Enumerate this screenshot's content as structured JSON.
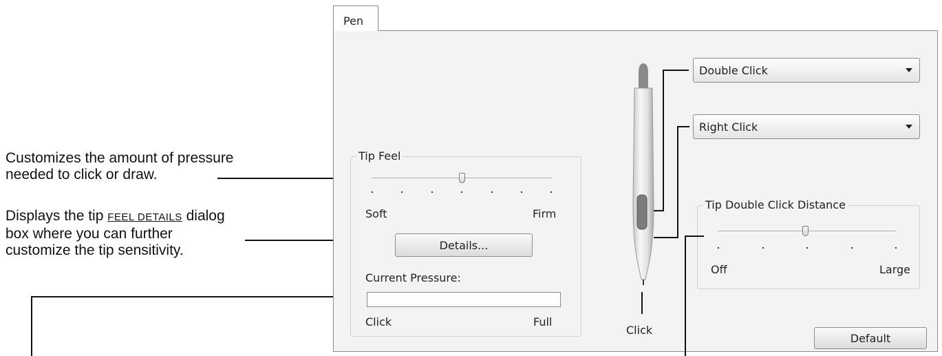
{
  "annotations": {
    "tip_feel_line1": "Customizes the amount of pressure",
    "tip_feel_line2": "needed to click or draw.",
    "details_prefix": "Displays the tip ",
    "details_link": "Feel Details",
    "details_suffix": " dialog",
    "details_line2": "box where you can further",
    "details_line3": "customize the tip sensitivity."
  },
  "tabs": {
    "pen": "Pen"
  },
  "tip_feel": {
    "title": "Tip Feel",
    "min_label": "Soft",
    "max_label": "Firm",
    "level": 0.5,
    "details_button": "Details...",
    "current_pressure_label": "Current Pressure:",
    "pressure_value": 0,
    "pressure_min_label": "Click",
    "pressure_max_label": "Full"
  },
  "pen": {
    "tip_label": "Click",
    "upper_button": "Double Click",
    "lower_button": "Right Click"
  },
  "tip_double_click": {
    "title": "Tip Double Click Distance",
    "min_label": "Off",
    "max_label": "Large",
    "level": 0.5
  },
  "default_button": "Default",
  "colors": {
    "panel_bg": "#f3f3f3",
    "border": "#8c8c8c",
    "text": "#222222"
  }
}
